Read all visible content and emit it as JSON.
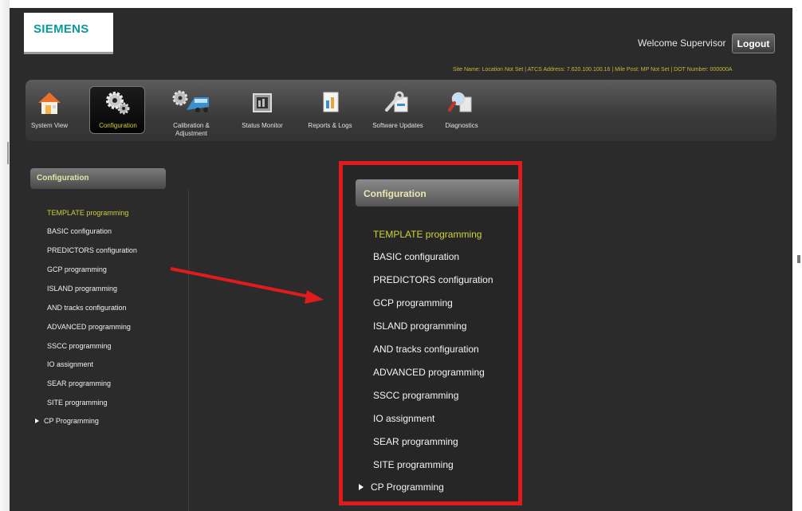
{
  "brand": {
    "logo_text": "SIEMENS"
  },
  "header": {
    "welcome": "Welcome Supervisor",
    "logout_label": "Logout",
    "site_info": "Site Name: Location Not Set | ATCS Address: 7.620.100.100.16 | Mile Post: MP Not Set | DOT Number: 000000A"
  },
  "nav": {
    "items": [
      {
        "label": "System View",
        "icon": "house-icon"
      },
      {
        "label": "Configuration",
        "icon": "gears-icon",
        "active": true
      },
      {
        "label": "Calibration & Adjustment",
        "icon": "gear-train-icon"
      },
      {
        "label": "Status Monitor",
        "icon": "monitor-icon"
      },
      {
        "label": "Reports & Logs",
        "icon": "report-icon"
      },
      {
        "label": "Software Updates",
        "icon": "tools-icon"
      },
      {
        "label": "Diagnostics",
        "icon": "magnifier-icon"
      }
    ]
  },
  "sidebar": {
    "header": "Configuration",
    "items": [
      "TEMPLATE programming",
      "BASIC configuration",
      "PREDICTORS configuration",
      "GCP programming",
      "ISLAND programming",
      "AND tracks configuration",
      "ADVANCED programming",
      "SSCC programming",
      "IO assignment",
      "SEAR programming",
      "SITE programming",
      "CP Programming"
    ],
    "selected_index": 0
  },
  "zoom": {
    "header": "Configuration",
    "items": [
      "TEMPLATE programming",
      "BASIC configuration",
      "PREDICTORS configuration",
      "GCP programming",
      "ISLAND programming",
      "AND tracks configuration",
      "ADVANCED programming",
      "SSCC programming",
      "IO assignment",
      "SEAR programming",
      "SITE programming",
      "CP Programming"
    ]
  },
  "colors": {
    "accent_yellow": "#c9d13c",
    "highlight_red": "#e01b1b",
    "brand_teal": "#0a9a9b"
  }
}
